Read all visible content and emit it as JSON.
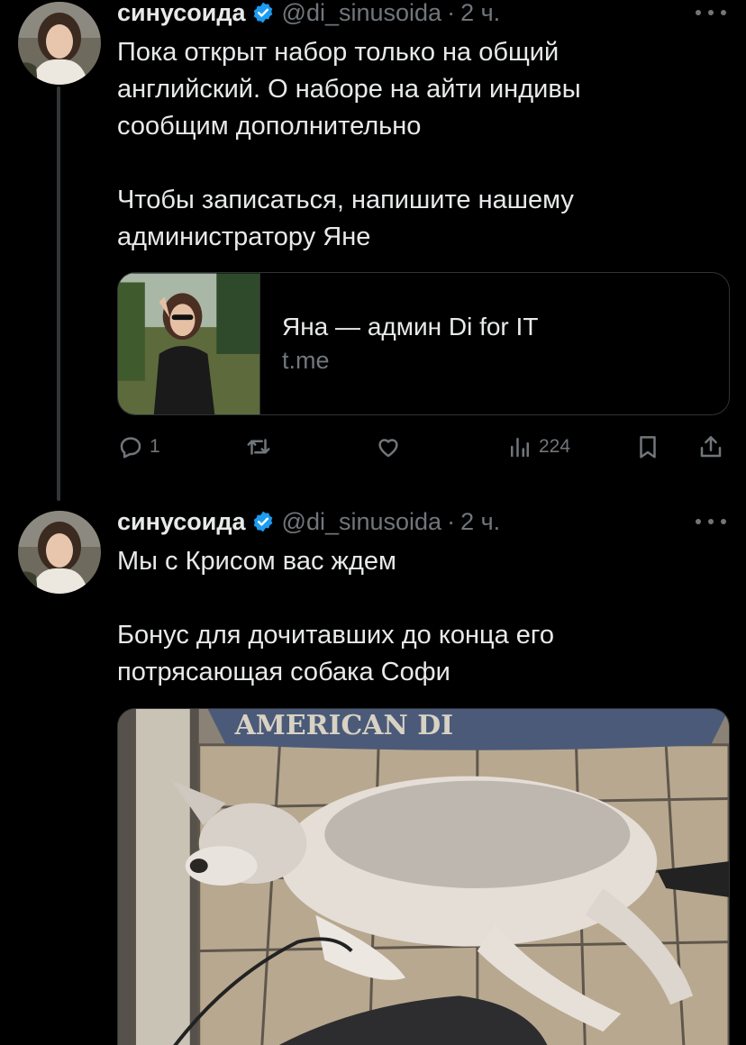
{
  "tweets": [
    {
      "author": {
        "name": "синусоида",
        "handle": "@di_sinusoida",
        "time": "2 ч."
      },
      "text_lines": [
        "Пока открыт набор только на общий",
        "английский. О наборе на айти индивы",
        "сообщим дополнительно",
        "",
        "Чтобы записаться, напишите нашему",
        "администратору Яне"
      ],
      "card": {
        "title": "Яна — админ Di for IT",
        "domain": "t.me"
      },
      "actions": {
        "replies": "1",
        "retweets": "",
        "likes": "",
        "views": "224"
      }
    },
    {
      "author": {
        "name": "синусоида",
        "handle": "@di_sinusoida",
        "time": "2 ч."
      },
      "text_lines": [
        "Мы с Крисом вас ждем",
        "",
        "Бонус для дочитавших до конца его",
        "потрясающая собака Софи"
      ],
      "media_text": "AMERICAN DI"
    }
  ],
  "icons": {
    "verified": "verified-badge-icon",
    "more": "more-icon",
    "reply": "reply-icon",
    "retweet": "retweet-icon",
    "like": "like-icon",
    "views": "views-icon",
    "bookmark": "bookmark-icon",
    "share": "share-icon"
  },
  "colors": {
    "background": "#000000",
    "text": "#e7e9ea",
    "secondary": "#71767b",
    "verified": "#1d9bf0",
    "border": "#2f3336"
  }
}
